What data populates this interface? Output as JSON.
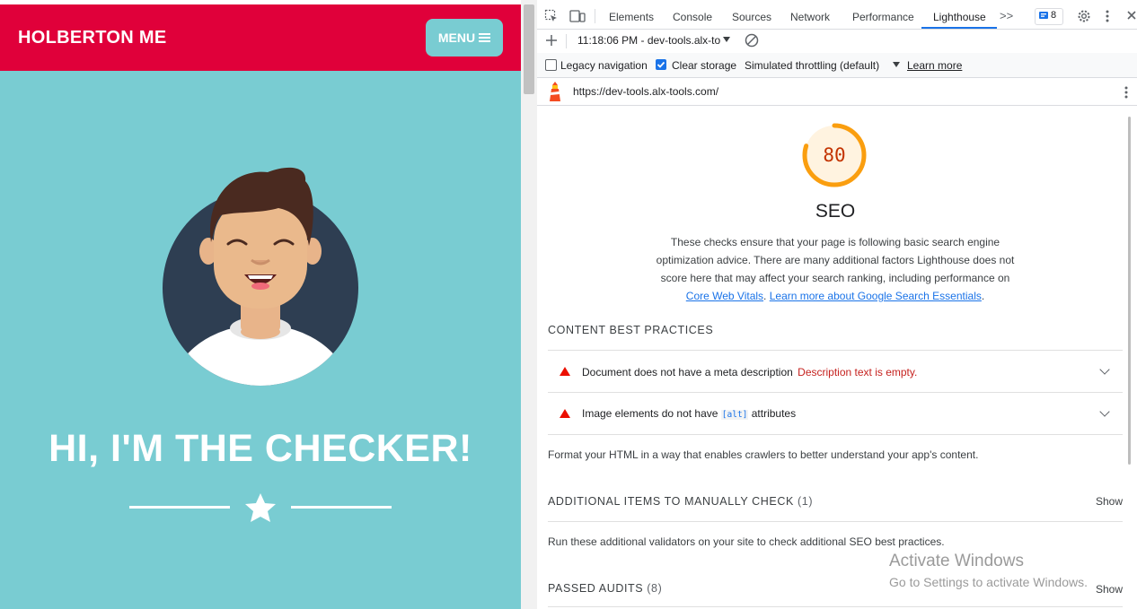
{
  "site": {
    "brand": "HOLBERTON ME",
    "menu_label": "MENU",
    "hero_title": "HI, I'M THE CHECKER!"
  },
  "devtools": {
    "tabs": [
      "Elements",
      "Console",
      "Sources",
      "Network",
      "Performance",
      "Lighthouse"
    ],
    "more_tabs": ">>",
    "issues_count": "8",
    "report_selector": "11:18:06 PM - dev-tools.alx-to",
    "options": {
      "legacy_navigation": "Legacy navigation",
      "clear_storage": "Clear storage",
      "throttling": "Simulated throttling (default)",
      "learn_more": "Learn more"
    },
    "url": "https://dev-tools.alx-tools.com/"
  },
  "report": {
    "score": "80",
    "score_color": "#fa9e0f",
    "category": "SEO",
    "description": {
      "line1": "These checks ensure that your page is following basic search engine",
      "line2": "optimization advice. There are many additional factors Lighthouse does not",
      "line3": "score here that may affect your search ranking, including performance on",
      "link1": "Core Web Vitals",
      "sep": ". ",
      "link2": "Learn more about Google Search Essentials",
      "end": "."
    },
    "content_best_practices": {
      "heading": "CONTENT BEST PRACTICES",
      "audits": [
        {
          "title": "Document does not have a meta description",
          "detail": "Description text is empty."
        },
        {
          "title_prefix": "Image elements do not have",
          "code": "[alt]",
          "title_suffix": "attributes"
        }
      ],
      "note": "Format your HTML in a way that enables crawlers to better understand your app's content."
    },
    "manual": {
      "heading": "ADDITIONAL ITEMS TO MANUALLY CHECK",
      "count": "(1)",
      "show": "Show",
      "note": "Run these additional validators on your site to check additional SEO best practices."
    },
    "passed": {
      "heading": "PASSED AUDITS",
      "count": "(8)",
      "show": "Show"
    }
  },
  "watermark": {
    "line1": "Activate Windows",
    "line2": "Go to Settings to activate Windows."
  }
}
